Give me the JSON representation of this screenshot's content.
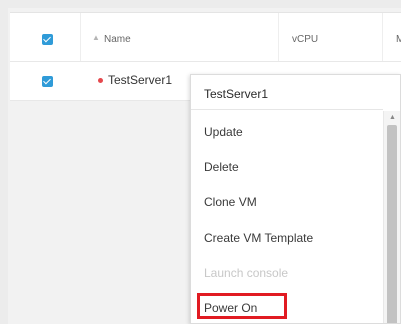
{
  "table": {
    "columns": [
      {
        "key": "name",
        "label": "Name"
      },
      {
        "key": "vcpu",
        "label": "vCPU"
      },
      {
        "key": "memory",
        "label": "M"
      }
    ],
    "rows": [
      {
        "name": "TestServer1",
        "status_color": "#e5484d",
        "selected": true
      }
    ],
    "select_all": true
  },
  "context_menu": {
    "title": "TestServer1",
    "items": [
      {
        "label": "Update",
        "enabled": true
      },
      {
        "label": "Delete",
        "enabled": true
      },
      {
        "label": "Clone VM",
        "enabled": true
      },
      {
        "label": "Create VM Template",
        "enabled": true
      },
      {
        "label": "Launch console",
        "enabled": false
      },
      {
        "label": "Power On",
        "enabled": true,
        "highlighted": true
      }
    ]
  },
  "colors": {
    "checkbox": "#2f9bd8",
    "status_off": "#e5484d",
    "highlight": "#e11b22"
  },
  "icons": {
    "sort": "sort-up-icon",
    "scroll_up": "chevron-up-icon"
  }
}
